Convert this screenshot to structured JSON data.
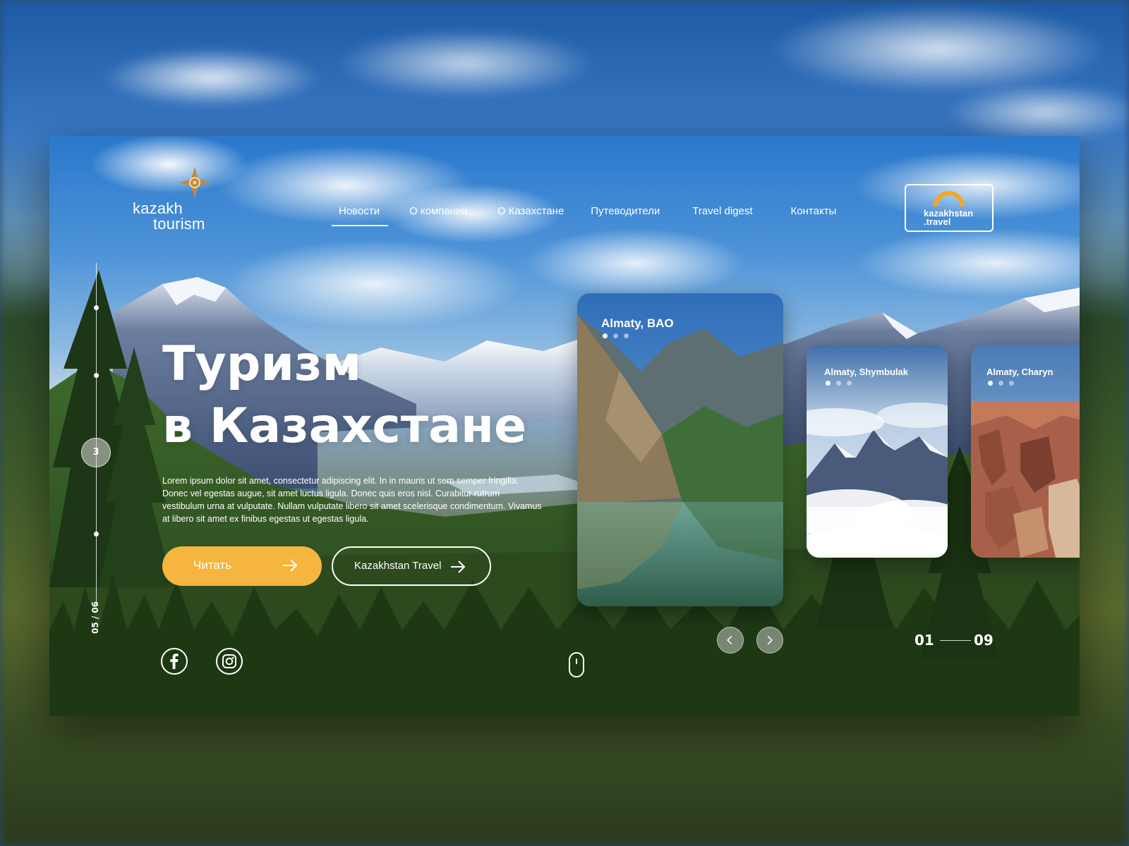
{
  "brand": {
    "line1": "kazakh",
    "line2": "tourism"
  },
  "nav": {
    "items": [
      {
        "label": "Новости",
        "active": true
      },
      {
        "label": "О компании",
        "active": false
      },
      {
        "label": "О Казахстане",
        "active": false
      },
      {
        "label": "Путеводители",
        "active": false
      },
      {
        "label": "Travel digest",
        "active": false
      },
      {
        "label": "Контакты",
        "active": false
      }
    ]
  },
  "partner": {
    "line1": "kazakhstan",
    "line2": ".travel"
  },
  "rail": {
    "current": "3",
    "count": "05 / 06"
  },
  "hero": {
    "title_line1": "Туризм",
    "title_line2": "в Казахстане",
    "text": "Lorem ipsum dolor sit amet, consectetur adipiscing elit. In in mauris ut sem semper fringilla. Donec vel egestas augue, sit amet luctus ligula. Donec quis eros nisl. Curabitur rutrum vestibulum urna at vulputate. Nullam vulputate libero sit amet scelerisque condimentum. Vivamus at libero sit amet ex finibus egestas ut egestas ligula.",
    "primary_button": "Читать",
    "secondary_button": "Kazakhstan Travel"
  },
  "cards": [
    {
      "title": "Almaty, BAO"
    },
    {
      "title": "Almaty, Shymbulak"
    },
    {
      "title": "Almaty, Charyn"
    }
  ],
  "slider": {
    "current": "01",
    "total": "09"
  },
  "colors": {
    "accent": "#f5b53f",
    "partner_arc": "#f5a623",
    "text": "#ffffff"
  },
  "icons": {
    "logo": "star-ornament-icon",
    "social": [
      "facebook-icon",
      "instagram-icon"
    ],
    "prev": "chevron-left-icon",
    "next": "chevron-right-icon",
    "scroll": "mouse-scroll-icon"
  }
}
